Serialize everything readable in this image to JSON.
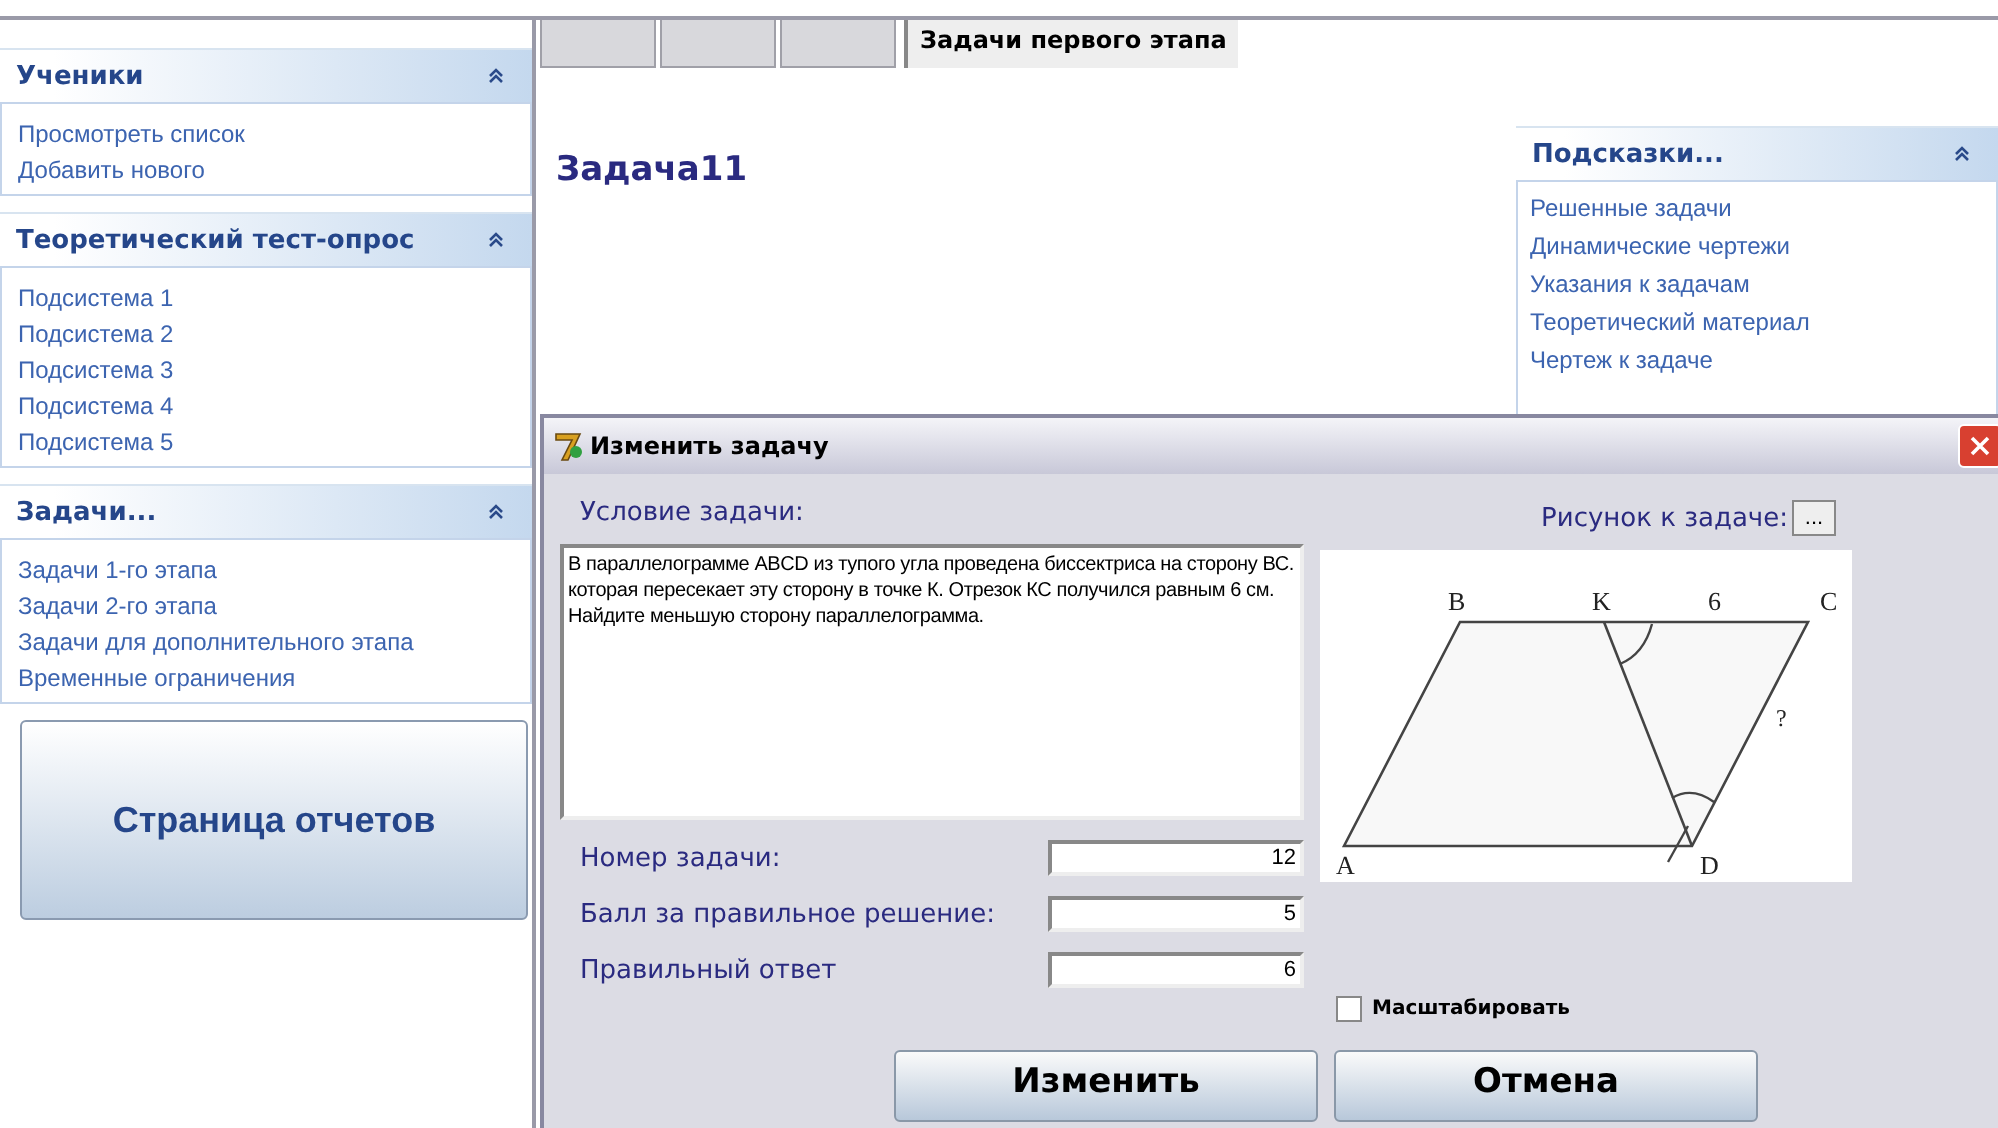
{
  "sidebar": {
    "panels": [
      {
        "title": "Ученики",
        "expanded": true,
        "items": [
          "Просмотреть список",
          "Добавить нового"
        ]
      },
      {
        "title": "Теоретический тест-опрос",
        "expanded": true,
        "items": [
          "Подсистема 1",
          "Подсистема 2",
          "Подсистема 3",
          "Подсистема 4",
          "Подсистема 5"
        ]
      },
      {
        "title": "Задачи...",
        "expanded": true,
        "items": [
          "Задачи 1-го этапа",
          "Задачи 2-го этапа",
          "Задачи для дополнительного этапа",
          "Временные ограничения"
        ]
      }
    ],
    "report_button": "Страница отчетов"
  },
  "tabs": [
    {
      "selected": false
    },
    {
      "selected": false
    },
    {
      "selected": false
    },
    {
      "label": "Задачи первого этапа",
      "selected": true
    }
  ],
  "task_title": "Задача11",
  "hints": {
    "title": "Подсказки...",
    "expanded": true,
    "items": [
      "Решенные задачи",
      "Динамические чертежи",
      "Указания к задачам",
      "Теоретический материал",
      "Чертеж к задаче"
    ]
  },
  "dialog": {
    "title": "Изменить задачу",
    "condition_label": "Условие задачи:",
    "condition_text": "В параллелограмме ABCD из тупого угла проведена биссектриса на сторону ВС. которая пересекает эту сторону  в точке К. Отрезок КС получился равным 6 см. Найдите меньшую сторону параллелограмма.",
    "picture_label": "Рисунок к задаче:",
    "browse_button": "...",
    "figure_labels": {
      "a": "A",
      "b": "B",
      "c": "C",
      "d": "D",
      "k": "K",
      "kc": "6",
      "cd": "?"
    },
    "fields": [
      {
        "label": "Номер задачи:",
        "value": "12"
      },
      {
        "label": "Балл за правильное решение:",
        "value": "5"
      },
      {
        "label": "Правильный ответ",
        "value": "6"
      }
    ],
    "scale_checkbox": {
      "label": "Масштабировать",
      "checked": false
    },
    "buttons": [
      "Изменить",
      "Отмена"
    ]
  }
}
